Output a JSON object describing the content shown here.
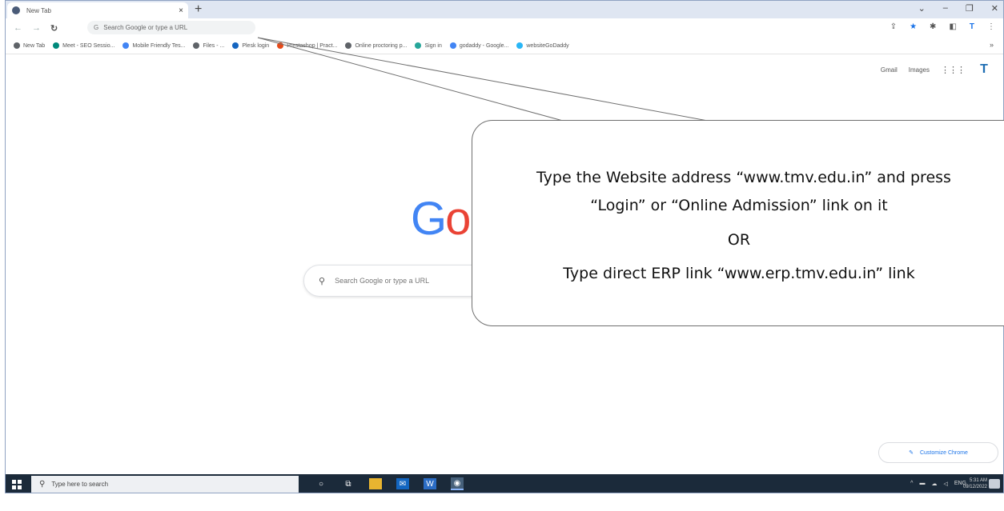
{
  "browser": {
    "tab_title": "New Tab",
    "tab_close": "×",
    "new_tab": "+",
    "omnibox_placeholder": "Search Google or type a URL",
    "bookmarks": [
      {
        "label": "New Tab",
        "color": "#5f6368"
      },
      {
        "label": "Meet - SEO Sessio...",
        "color": "#00897b"
      },
      {
        "label": "Mobile Friendly Tes...",
        "color": "#4285f4"
      },
      {
        "label": "Files - ...",
        "color": "#5f6368"
      },
      {
        "label": "Plesk login",
        "color": "#1565c0"
      },
      {
        "label": "Prestashop | Pract...",
        "color": "#e64a19"
      },
      {
        "label": "Online proctoring p...",
        "color": "#5f6368"
      },
      {
        "label": "Sign in",
        "color": "#26a69a"
      },
      {
        "label": "godaddy - Google...",
        "color": "#4285f4"
      },
      {
        "label": "websiteGoDaddy",
        "color": "#29b6f6"
      }
    ],
    "bookmarks_more": "»"
  },
  "newtab": {
    "gmail": "Gmail",
    "images": "Images",
    "avatar": "T",
    "logo_g": "G",
    "logo_o": "o",
    "search_placeholder": "Search Google or type a URL",
    "customize": "Customize Chrome"
  },
  "callout": {
    "line1": "Type the Website address “www.tmv.edu.in” and press",
    "line2": "“Login” or “Online Admission” link on it",
    "line3": "OR",
    "line4": "Type direct ERP link “www.erp.tmv.edu.in” link"
  },
  "taskbar": {
    "search_placeholder": "Type here to search",
    "time": "5:31 AM",
    "date": "09/12/2022"
  }
}
